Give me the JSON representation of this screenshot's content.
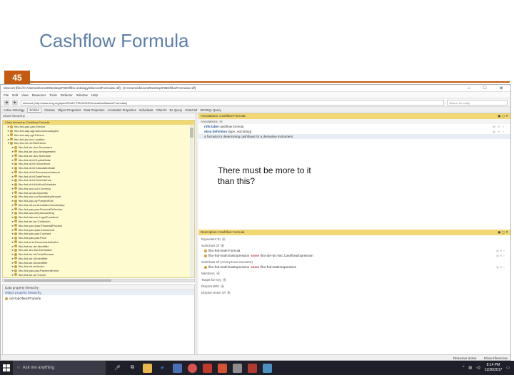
{
  "slide": {
    "title": "Cashflow Formula",
    "number": "45",
    "note": "There must be more to it than this?"
  },
  "app": {
    "title_path": "ebscont [file://C:/Users/ebscont/Desktop/FIBO/fibo-ontology/ebscont/Formulas.rdf] : [C:/Users/ebscont/Desktop/FIBO/fibo/Formulas.rdf]",
    "menu": [
      "File",
      "Edit",
      "View",
      "Reasoner",
      "Tools",
      "Refactor",
      "Window",
      "Help"
    ],
    "url": "ebscont (http://www.omg.org/spec/EDMC-FIBO/DER/DerivativesBasics/Formulas/)",
    "search_placeholder": "Search for entity",
    "tabs": [
      "Active Ontology",
      "Entities",
      "Classes",
      "Object Properties",
      "Data Properties",
      "Annotation Properties",
      "Individuals",
      "OWLViz",
      "DL Query",
      "OntoGraf",
      "SPARQL Query"
    ],
    "active_tab": "Entities",
    "left_header": "Class hierarchy",
    "tree_header": "Class hierarchy: Cashflow Formula",
    "tree": [
      {
        "label": "fibo-fnd-pas-pas:Service",
        "depth": 1,
        "exp": "►"
      },
      {
        "label": "fibo-fnd-aap-agt:AutonomousAgent",
        "depth": 1,
        "exp": "►"
      },
      {
        "label": "fibo-fnd-aap-ppl:Person",
        "depth": 1,
        "exp": "►"
      },
      {
        "label": "fibo-fnd-plc-loc:Location",
        "depth": 1,
        "exp": "►"
      },
      {
        "label": "fibo-fnd-rel-rel:Reference",
        "depth": 1,
        "exp": "▼"
      },
      {
        "label": "fibo-fnd-arr-doc:Document",
        "depth": 2,
        "exp": "►"
      },
      {
        "label": "fibo-fnd-arr-doc:Arrangement",
        "depth": 2,
        "exp": "►"
      },
      {
        "label": "fibo-fnd-arr-doc:Schedule",
        "depth": 2,
        "exp": "►"
      },
      {
        "label": "fibo-fnd-dt-fd:ExplicitDate",
        "depth": 2,
        "exp": "►"
      },
      {
        "label": "fibo-fnd-dt-fd:Occurrence",
        "depth": 2,
        "exp": "►"
      },
      {
        "label": "fibo-fnd-dt-fd:CalculatedDate",
        "depth": 2,
        "exp": "►"
      },
      {
        "label": "fibo-fnd-dt-fd:RecurrenceInterval",
        "depth": 2,
        "exp": "►"
      },
      {
        "label": "fibo-fnd-dt-fd:DatePeriod",
        "depth": 2,
        "exp": "►"
      },
      {
        "label": "fibo-fnd-dt-fd:TimeInterval",
        "depth": 2,
        "exp": "►"
      },
      {
        "label": "fibo-fnd-dt-fd:AdHocSchedule",
        "depth": 2,
        "exp": "►"
      },
      {
        "label": "fibo-fnd-acc-cur:Currency",
        "depth": 2,
        "exp": "►"
      },
      {
        "label": "fibo-fnd-qt-qtu:Quantity",
        "depth": 2,
        "exp": "►"
      },
      {
        "label": "fibo-fnd-acc-cur:MonetaryAmount",
        "depth": 2,
        "exp": "►"
      },
      {
        "label": "fibo-fnd-pty-pty:PartyInRole",
        "depth": 2,
        "exp": "►"
      },
      {
        "label": "fibo-fnd-utl-av:AnnotationVocabulary",
        "depth": 2,
        "exp": "►"
      },
      {
        "label": "fibo-fnd-pas-pas:ProductOrService",
        "depth": 2,
        "exp": "►"
      },
      {
        "label": "fibo-fnd-acc-aeq:Accounting",
        "depth": 2,
        "exp": "►"
      },
      {
        "label": "fibo-fnd-law-cor:LegalConstruct",
        "depth": 2,
        "exp": "►"
      },
      {
        "label": "fibo-fnd-arr-arr:Collection",
        "depth": 2,
        "exp": "►"
      },
      {
        "label": "fibo-fnd-pas-fpas:FinancialProduct",
        "depth": 2,
        "exp": "►"
      },
      {
        "label": "fibo-fnd-pas-fpas:Instrument",
        "depth": 2,
        "exp": "►"
      },
      {
        "label": "fibo-fnd-pas-pas:Contract",
        "depth": 2,
        "exp": "►"
      },
      {
        "label": "fibo-fnd-pas-pas:Price",
        "depth": 2,
        "exp": "►"
      },
      {
        "label": "fibo-ind-ei-ei:EconomicIndicator",
        "depth": 2,
        "exp": "►"
      },
      {
        "label": "fibo-fnd-arr-arr:Identifier",
        "depth": 2,
        "exp": "►"
      },
      {
        "label": "fibo-der-drc-bsc:Derivative",
        "depth": 2,
        "exp": "►"
      },
      {
        "label": "fibo-fnd-arr-id:CodeElement",
        "depth": 2,
        "exp": "►"
      },
      {
        "label": "fibo-fnd-arr-id:Identifier",
        "depth": 2,
        "exp": "►"
      },
      {
        "label": "fibo-fnd-arr-id:Identifier",
        "depth": 2,
        "exp": "►"
      },
      {
        "label": "fibo-fnd-rel-rel:Index",
        "depth": 2,
        "exp": "►"
      },
      {
        "label": "fibo-fnd-pas-pas:PaymentEvent",
        "depth": 2,
        "exp": "►"
      },
      {
        "label": "fibo-fnd-arr-arr:Factor",
        "depth": 2,
        "exp": "►"
      },
      {
        "label": "fibo-fnd-math:Constant",
        "depth": 2,
        "exp": "►"
      },
      {
        "label": "fibo-fnd-math:Expression",
        "depth": 2,
        "exp": "►"
      },
      {
        "label": "fibo-fnd-math:Formula",
        "depth": 2,
        "exp": "▼"
      },
      {
        "label": "fibo-fnd-math:CashflowFormula",
        "depth": 3,
        "exp": "",
        "selected": true
      },
      {
        "label": "fibo-fnd-math:CalculationFormula",
        "depth": 3,
        "exp": ""
      },
      {
        "label": "fibo-fnd-math:Variable",
        "depth": 2,
        "exp": "►"
      },
      {
        "label": "fibo-fnd-math:Operator",
        "depth": 2,
        "exp": "►"
      },
      {
        "label": "fibo-fnd-math:Operand",
        "depth": 2,
        "exp": "►"
      }
    ],
    "lower_left_header": "Data property hierarchy",
    "lower_left_sub": "Object property hierarchy:",
    "lower_left_item": "owl:topObjectProperty",
    "annotations": {
      "title": "Annotations: Cashflow Formula",
      "sub": "Annotations",
      "rows": [
        {
          "key": "rdfs:label",
          "value": "cashflow formula"
        },
        {
          "key": "skos:definition",
          "value": "[type: xsd:string]"
        },
        {
          "key": "",
          "value": "a formula for determining cashflows for a derivative instrument"
        }
      ]
    },
    "description": {
      "title": "Description: Cashflow Formula",
      "equivalent_label": "Equivalent To",
      "subclass_label": "SubClass Of",
      "subclass_rows": [
        {
          "text": "fibo-fnd-math:Formula",
          "kw": "",
          "rest": ""
        },
        {
          "text": "fibo-fnd-math:hasExpression",
          "kw": "some",
          "rest": "fibo-der-drc-bsc:CashflowExpression"
        }
      ],
      "inherited_label": "SubClass Of (Anonymous Ancestor)",
      "inherited_rows": [
        {
          "text": "fibo-fnd-math:hasExpression",
          "kw": "some",
          "rest": "fibo-fnd-math:Expression"
        }
      ],
      "members_label": "Members",
      "target_label": "Target for Key",
      "disjoint_label": "Disjoint With",
      "disjoint_union_label": "Disjoint Union Of"
    },
    "status": [
      "Reasoner active",
      "Show Inferences"
    ]
  },
  "taskbar": {
    "search_text": "Ask me anything",
    "time": "8:14 PM",
    "date": "11/26/2017"
  },
  "colors": {
    "accent": "#c55a11",
    "title": "#5b7fa8",
    "tree_bg": "#fefbd0",
    "section_bg": "#f2d873"
  }
}
